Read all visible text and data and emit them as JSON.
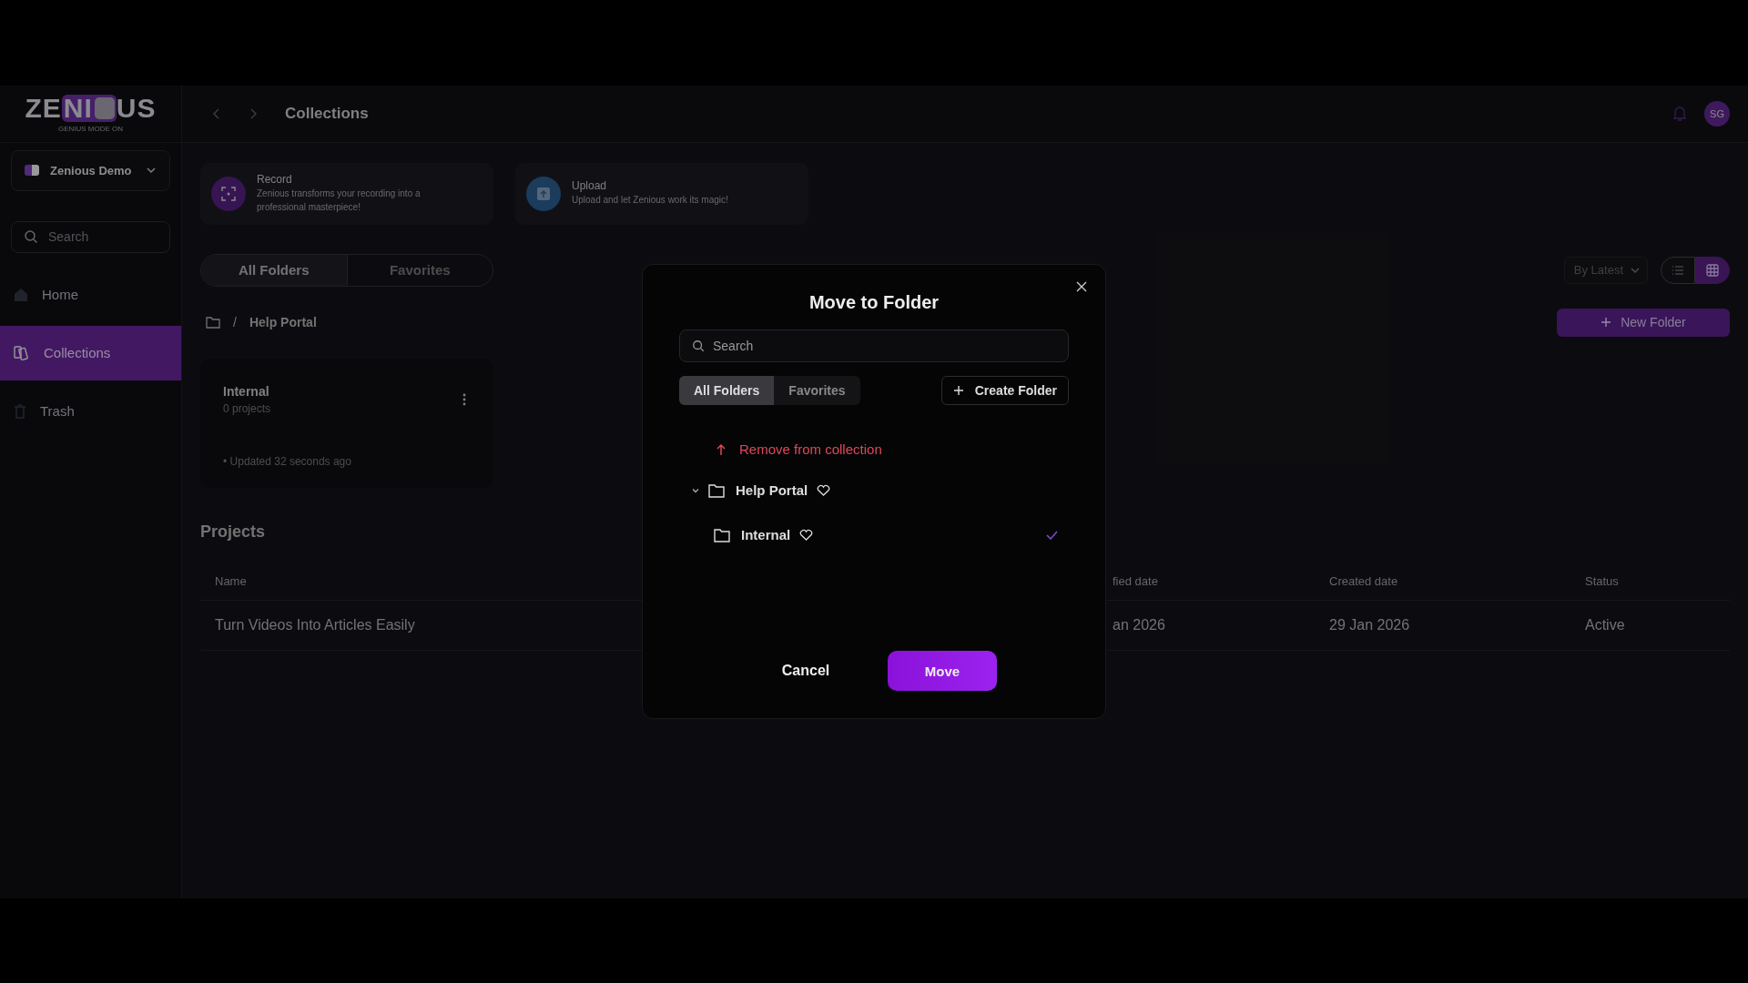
{
  "logo": {
    "lead": "ZE",
    "highlight": "NI",
    "tail": "US",
    "tagline": "GENIUS MODE ON"
  },
  "header": {
    "title": "Collections",
    "avatar": "SG"
  },
  "workspace": {
    "name": "Zenious Demo"
  },
  "sidebar": {
    "search": {
      "placeholder": "Search"
    },
    "items": [
      {
        "label": "Home",
        "kind": "home",
        "selected": false
      },
      {
        "label": "Collections",
        "kind": "collections",
        "selected": true
      },
      {
        "label": "Trash",
        "kind": "trash",
        "selected": false
      }
    ]
  },
  "actions": [
    {
      "kind": "record",
      "title": "Record",
      "text": "Zenious transforms your recording into a professional masterpiece!"
    },
    {
      "kind": "upload",
      "title": "Upload",
      "text": "Upload and let Zenious work its magic!"
    }
  ],
  "tabs": [
    {
      "label": "All Folders",
      "selected": true
    },
    {
      "label": "Favorites",
      "selected": false
    }
  ],
  "breadcrumb": {
    "separator": "/",
    "current": "Help Portal"
  },
  "sort": {
    "value": "By Latest"
  },
  "views": [
    {
      "kind": "list",
      "selected": false
    },
    {
      "kind": "grid",
      "selected": true
    }
  ],
  "new_folder": "New Folder",
  "folders": [
    {
      "name": "Internal",
      "count": "0 projects",
      "updated": "• Updated 32 seconds ago"
    }
  ],
  "projects": {
    "title": "Projects",
    "columns": [
      "Name",
      "fied date",
      "Created date",
      "Status"
    ],
    "rows": [
      {
        "cells": [
          "Turn Videos Into Articles Easily",
          "an 2026",
          "29 Jan 2026",
          "Active"
        ]
      }
    ]
  },
  "modal": {
    "title": "Move to Folder",
    "search": {
      "placeholder": "Search"
    },
    "tabs": [
      {
        "label": "All Folders",
        "selected": true
      },
      {
        "label": "Favorites",
        "selected": false
      }
    ],
    "create": "Create Folder",
    "remove": "Remove from collection",
    "tree": [
      {
        "name": "Help Portal",
        "expanded": true,
        "favorite": false,
        "selected": false,
        "children": [
          {
            "name": "Internal",
            "favorite": false,
            "selected": true
          }
        ]
      }
    ],
    "cancel": "Cancel",
    "confirm": "Move"
  }
}
